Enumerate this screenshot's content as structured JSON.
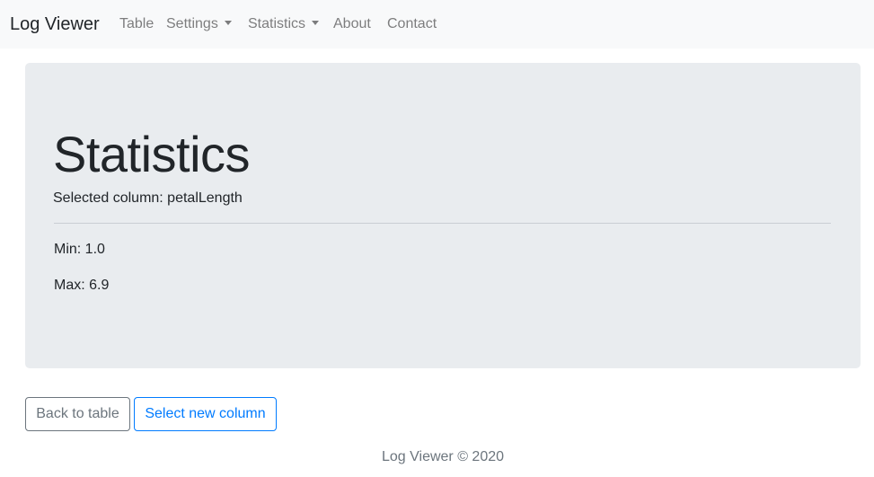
{
  "navbar": {
    "brand": "Log Viewer",
    "items": [
      {
        "label": "Table"
      },
      {
        "label": "Settings"
      },
      {
        "label": "Statistics"
      },
      {
        "label": "About"
      },
      {
        "label": "Contact"
      }
    ]
  },
  "main": {
    "title": "Statistics",
    "selected_column": "Selected column: petalLength",
    "min": "Min: 1.0",
    "max": "Max: 6.9"
  },
  "actions": {
    "back_label": "Back to table",
    "select_label": "Select new column"
  },
  "footer": {
    "text": "Log Viewer © 2020"
  }
}
